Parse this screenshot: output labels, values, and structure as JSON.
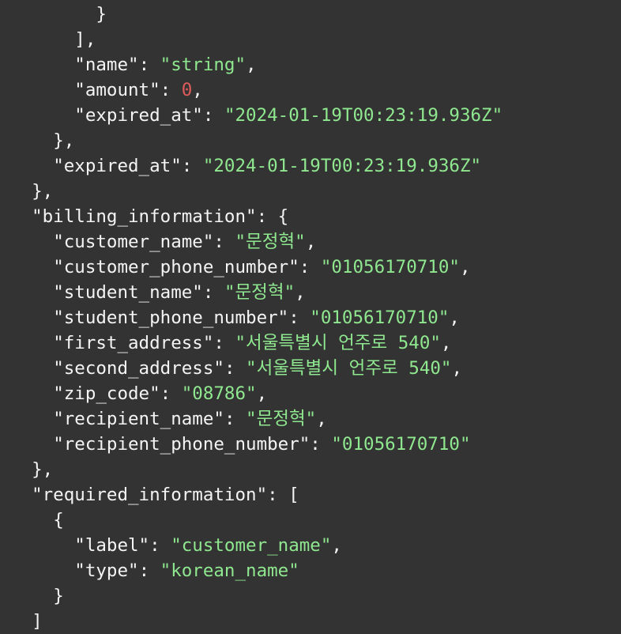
{
  "colors": {
    "background": "#333333",
    "key": "#f4f4f4",
    "string": "#8fe88f",
    "number": "#e05c5c"
  },
  "lines": [
    {
      "indent": 8,
      "tokens": [
        {
          "t": "punct",
          "v": "}"
        }
      ]
    },
    {
      "indent": 6,
      "tokens": [
        {
          "t": "punct",
          "v": "],"
        }
      ]
    },
    {
      "indent": 6,
      "tokens": [
        {
          "t": "key",
          "v": "\"name\""
        },
        {
          "t": "punct",
          "v": ": "
        },
        {
          "t": "str",
          "v": "\"string\""
        },
        {
          "t": "punct",
          "v": ","
        }
      ]
    },
    {
      "indent": 6,
      "tokens": [
        {
          "t": "key",
          "v": "\"amount\""
        },
        {
          "t": "punct",
          "v": ": "
        },
        {
          "t": "num",
          "v": "0"
        },
        {
          "t": "punct",
          "v": ","
        }
      ]
    },
    {
      "indent": 6,
      "tokens": [
        {
          "t": "key",
          "v": "\"expired_at\""
        },
        {
          "t": "punct",
          "v": ": "
        },
        {
          "t": "str",
          "v": "\"2024-01-19T00:23:19.936Z\""
        }
      ]
    },
    {
      "indent": 4,
      "tokens": [
        {
          "t": "punct",
          "v": "},"
        }
      ]
    },
    {
      "indent": 4,
      "tokens": [
        {
          "t": "key",
          "v": "\"expired_at\""
        },
        {
          "t": "punct",
          "v": ": "
        },
        {
          "t": "str",
          "v": "\"2024-01-19T00:23:19.936Z\""
        }
      ]
    },
    {
      "indent": 2,
      "tokens": [
        {
          "t": "punct",
          "v": "},"
        }
      ]
    },
    {
      "indent": 2,
      "tokens": [
        {
          "t": "key",
          "v": "\"billing_information\""
        },
        {
          "t": "punct",
          "v": ": {"
        }
      ]
    },
    {
      "indent": 4,
      "tokens": [
        {
          "t": "key",
          "v": "\"customer_name\""
        },
        {
          "t": "punct",
          "v": ": "
        },
        {
          "t": "str",
          "v": "\"문정혁\""
        },
        {
          "t": "punct",
          "v": ","
        }
      ]
    },
    {
      "indent": 4,
      "tokens": [
        {
          "t": "key",
          "v": "\"customer_phone_number\""
        },
        {
          "t": "punct",
          "v": ": "
        },
        {
          "t": "str",
          "v": "\"01056170710\""
        },
        {
          "t": "punct",
          "v": ","
        }
      ]
    },
    {
      "indent": 4,
      "tokens": [
        {
          "t": "key",
          "v": "\"student_name\""
        },
        {
          "t": "punct",
          "v": ": "
        },
        {
          "t": "str",
          "v": "\"문정혁\""
        },
        {
          "t": "punct",
          "v": ","
        }
      ]
    },
    {
      "indent": 4,
      "tokens": [
        {
          "t": "key",
          "v": "\"student_phone_number\""
        },
        {
          "t": "punct",
          "v": ": "
        },
        {
          "t": "str",
          "v": "\"01056170710\""
        },
        {
          "t": "punct",
          "v": ","
        }
      ]
    },
    {
      "indent": 4,
      "tokens": [
        {
          "t": "key",
          "v": "\"first_address\""
        },
        {
          "t": "punct",
          "v": ": "
        },
        {
          "t": "str",
          "v": "\"서울특별시 언주로 540\""
        },
        {
          "t": "punct",
          "v": ","
        }
      ]
    },
    {
      "indent": 4,
      "tokens": [
        {
          "t": "key",
          "v": "\"second_address\""
        },
        {
          "t": "punct",
          "v": ": "
        },
        {
          "t": "str",
          "v": "\"서울특별시 언주로 540\""
        },
        {
          "t": "punct",
          "v": ","
        }
      ]
    },
    {
      "indent": 4,
      "tokens": [
        {
          "t": "key",
          "v": "\"zip_code\""
        },
        {
          "t": "punct",
          "v": ": "
        },
        {
          "t": "str",
          "v": "\"08786\""
        },
        {
          "t": "punct",
          "v": ","
        }
      ]
    },
    {
      "indent": 4,
      "tokens": [
        {
          "t": "key",
          "v": "\"recipient_name\""
        },
        {
          "t": "punct",
          "v": ": "
        },
        {
          "t": "str",
          "v": "\"문정혁\""
        },
        {
          "t": "punct",
          "v": ","
        }
      ]
    },
    {
      "indent": 4,
      "tokens": [
        {
          "t": "key",
          "v": "\"recipient_phone_number\""
        },
        {
          "t": "punct",
          "v": ": "
        },
        {
          "t": "str",
          "v": "\"01056170710\""
        }
      ]
    },
    {
      "indent": 2,
      "tokens": [
        {
          "t": "punct",
          "v": "},"
        }
      ]
    },
    {
      "indent": 2,
      "tokens": [
        {
          "t": "key",
          "v": "\"required_information\""
        },
        {
          "t": "punct",
          "v": ": ["
        }
      ]
    },
    {
      "indent": 4,
      "tokens": [
        {
          "t": "punct",
          "v": "{"
        }
      ]
    },
    {
      "indent": 6,
      "tokens": [
        {
          "t": "key",
          "v": "\"label\""
        },
        {
          "t": "punct",
          "v": ": "
        },
        {
          "t": "str",
          "v": "\"customer_name\""
        },
        {
          "t": "punct",
          "v": ","
        }
      ]
    },
    {
      "indent": 6,
      "tokens": [
        {
          "t": "key",
          "v": "\"type\""
        },
        {
          "t": "punct",
          "v": ": "
        },
        {
          "t": "str",
          "v": "\"korean_name\""
        }
      ]
    },
    {
      "indent": 4,
      "tokens": [
        {
          "t": "punct",
          "v": "}"
        }
      ]
    },
    {
      "indent": 2,
      "tokens": [
        {
          "t": "punct",
          "v": "]"
        }
      ]
    }
  ]
}
